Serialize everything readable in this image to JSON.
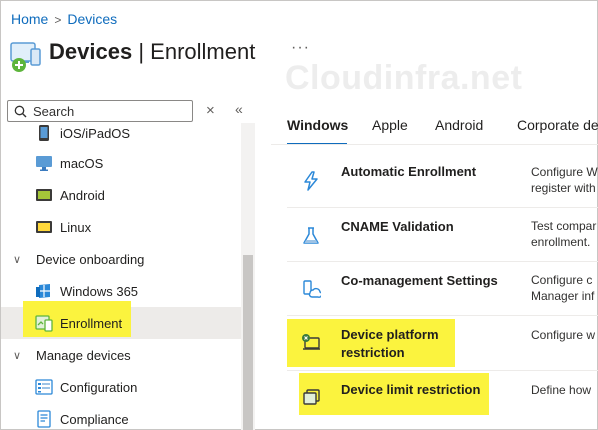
{
  "breadcrumb": {
    "home": "Home",
    "separator": ">",
    "current": "Devices"
  },
  "header": {
    "title_strong": "Devices",
    "title_sep": "|",
    "title_light": "Enrollment",
    "more": "···"
  },
  "watermark": "Cloudinfra.net",
  "search": {
    "placeholder": "Search",
    "clear_icon": "×",
    "collapse_icon": "«"
  },
  "sidebar": {
    "items": [
      {
        "label": "iOS/iPadOS",
        "icon": "ios-device-icon"
      },
      {
        "label": "macOS",
        "icon": "monitor-icon"
      },
      {
        "label": "Android",
        "icon": "android-icon"
      },
      {
        "label": "Linux",
        "icon": "linux-icon"
      },
      {
        "label": "Device onboarding",
        "group": true,
        "chevron": "∨"
      },
      {
        "label": "Windows 365",
        "icon": "windows365-icon"
      },
      {
        "label": "Enrollment",
        "icon": "enrollment-icon",
        "selected": true,
        "highlighted": true
      },
      {
        "label": "Manage devices",
        "group": true,
        "chevron": "∨"
      },
      {
        "label": "Configuration",
        "icon": "configuration-icon"
      },
      {
        "label": "Compliance",
        "icon": "compliance-icon"
      }
    ]
  },
  "tabs": [
    {
      "label": "Windows",
      "active": true
    },
    {
      "label": "Apple"
    },
    {
      "label": "Android"
    },
    {
      "label": "Corporate de"
    }
  ],
  "rows": [
    {
      "name": "Automatic Enrollment",
      "desc": [
        "Configure W",
        "register with"
      ],
      "icon": "lightning-icon"
    },
    {
      "name": "CNAME Validation",
      "desc": [
        "Test compar",
        "enrollment."
      ],
      "icon": "flask-icon"
    },
    {
      "name": "Co-management Settings",
      "desc": [
        "Configure c",
        "Manager inf"
      ],
      "icon": "co-management-icon"
    },
    {
      "name": [
        "Device platform",
        "restriction"
      ],
      "desc": [
        "Configure w"
      ],
      "icon": "platform-restriction-icon",
      "highlighted": true
    },
    {
      "name": "Device limit restriction",
      "desc": [
        "Define how"
      ],
      "icon": "device-limit-icon",
      "highlighted": true
    }
  ],
  "colors": {
    "accent": "#0f6cbd",
    "highlight": "#fbf33e",
    "selected_bg": "#edebe9"
  }
}
